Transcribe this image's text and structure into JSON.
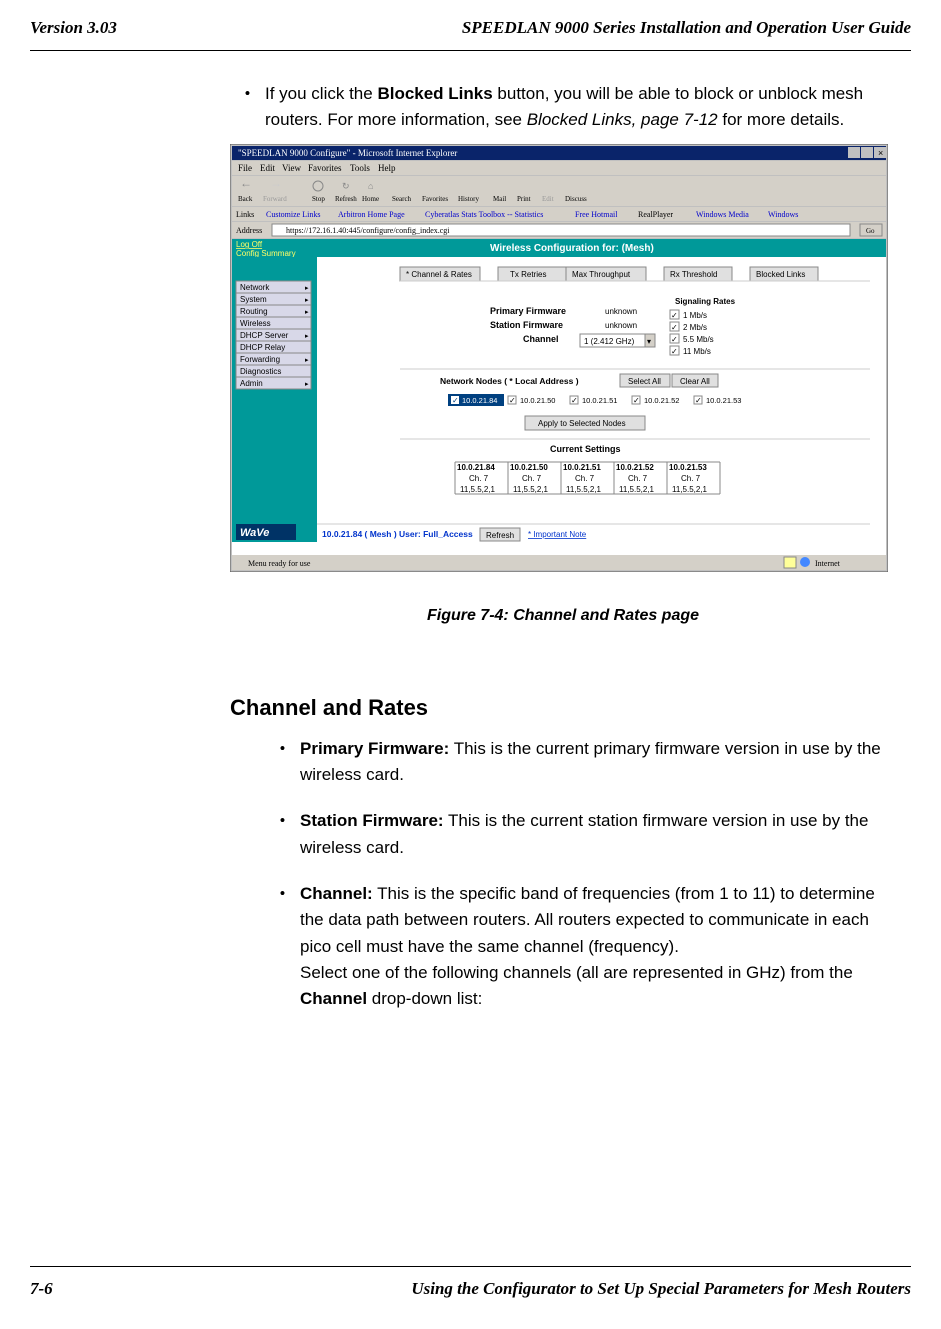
{
  "header": {
    "left": "Version 3.03",
    "right": "SPEEDLAN 9000 Series Installation and Operation User Guide"
  },
  "intro_bullet": {
    "pre": "If you click the ",
    "bold": "Blocked Links",
    "mid": " button, you will be able to block or unblock mesh routers. For more information, see ",
    "italic": "Blocked Links, page 7-12",
    "post": " for more details."
  },
  "figure_caption": "Figure 7-4: Channel and Rates page",
  "section": {
    "title": "Channel and Rates",
    "items": [
      {
        "label": "Primary Firmware:",
        "text": " This is the current primary firmware version in use by the wireless card."
      },
      {
        "label": "Station Firmware:",
        "text": " This is the current station firmware version in use by the wireless card."
      },
      {
        "label": "Channel:",
        "text": " This is the specific band of frequencies (from 1 to 11) to determine the data path between routers. All routers expected to communicate in each pico cell must have the same channel (frequency).",
        "extra_pre": "Select one of the following channels (all are represented in GHz) from the ",
        "extra_bold": "Channel",
        "extra_post": " drop-down list:"
      }
    ]
  },
  "footer": {
    "left": "7-6",
    "right": "Using the Configurator to Set Up Special Parameters for Mesh Routers"
  },
  "screenshot": {
    "title": "\"SPEEDLAN 9000 Configure\" - Microsoft Internet Explorer",
    "menu": [
      "File",
      "Edit",
      "View",
      "Favorites",
      "Tools",
      "Help"
    ],
    "toolbar": [
      "Back",
      "Forward",
      "Stop",
      "Refresh",
      "Home",
      "Search",
      "Favorites",
      "History",
      "Mail",
      "Print",
      "Edit",
      "Discuss"
    ],
    "links_bar": [
      "Customize Links",
      "Arbitron Home Page",
      "Cyberatlas Stats Toolbox -- Statistics",
      "Free Hotmail",
      "RealPlayer",
      "Windows Media",
      "Windows"
    ],
    "address": "https://172.16.1.40:445/configure/config_index.cgi",
    "left_panel": {
      "top_links": [
        "Log Off",
        "Config Summary"
      ],
      "menu": [
        "Network",
        "System",
        "Routing",
        "Wireless",
        "DHCP Server",
        "DHCP Relay",
        "Forwarding",
        "Diagnostics",
        "Admin"
      ]
    },
    "page_title": "Wireless Configuration for: (Mesh)",
    "tabs": [
      "* Channel & Rates",
      "Tx Retries",
      "Max Throughput",
      "Rx Threshold",
      "Blocked Links"
    ],
    "firmware_labels": [
      "Primary Firmware",
      "Station Firmware",
      "Channel"
    ],
    "firmware_values": [
      "unknown",
      "unknown",
      "1 (2.412 GHz)"
    ],
    "rates_heading": "Signaling Rates",
    "rates": [
      "1 Mb/s",
      "2 Mb/s",
      "5.5 Mb/s",
      "11 Mb/s"
    ],
    "nodes_label": "Network Nodes ( * Local Address )",
    "select_all": "Select All",
    "clear_all": "Clear All",
    "nodes": [
      "10.0.21.84",
      "10.0.21.50",
      "10.0.21.51",
      "10.0.21.52",
      "10.0.21.53"
    ],
    "apply_btn": "Apply to Selected Nodes",
    "current_settings": "Current Settings",
    "settings_cols": [
      "10.0.21.84",
      "10.0.21.50",
      "10.0.21.51",
      "10.0.21.52",
      "10.0.21.53"
    ],
    "settings_row1": "Ch. 7",
    "settings_row2": "11,5.5,2,1",
    "bottom_text": "10.0.21.84 ( Mesh ) User: Full_Access",
    "refresh": "Refresh",
    "imp_note": "* Important Note",
    "status_left": "Menu ready for use",
    "status_right": "Internet"
  }
}
